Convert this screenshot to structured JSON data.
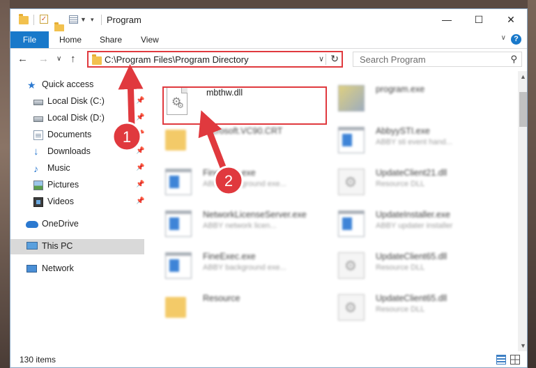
{
  "window": {
    "title": "Program",
    "controls": {
      "minimize": "—",
      "maximize": "☐",
      "close": "✕"
    }
  },
  "ribbon": {
    "file_tab": "File",
    "tabs": [
      "Home",
      "Share",
      "View"
    ]
  },
  "address": {
    "path": "C:\\Program Files\\Program Directory",
    "search_placeholder": "Search Program"
  },
  "nav": {
    "items": [
      {
        "label": "Quick access",
        "icon": "star-icon"
      },
      {
        "label": "Local Disk (C:)",
        "icon": "drive-icon",
        "pinned": true
      },
      {
        "label": "Local Disk (D:)",
        "icon": "drive-icon",
        "pinned": true
      },
      {
        "label": "Documents",
        "icon": "documents-icon",
        "pinned": true
      },
      {
        "label": "Downloads",
        "icon": "download-icon",
        "pinned": true
      },
      {
        "label": "Music",
        "icon": "music-icon",
        "pinned": true
      },
      {
        "label": "Pictures",
        "icon": "pictures-icon",
        "pinned": true
      },
      {
        "label": "Videos",
        "icon": "videos-icon",
        "pinned": true
      },
      {
        "label": "OneDrive",
        "icon": "cloud-icon"
      },
      {
        "label": "This PC",
        "icon": "pc-icon",
        "selected": true
      },
      {
        "label": "Network",
        "icon": "network-icon"
      }
    ]
  },
  "files": {
    "highlighted": {
      "name": "mbthw.dll"
    },
    "items": [
      {
        "name": "program.exe",
        "desc": "",
        "icon": "program-icon"
      },
      {
        "name": "Microsoft.VC90.CRT",
        "desc": "",
        "icon": "folder-icon"
      },
      {
        "name": "AbbyySTI.exe",
        "desc": "ABBY sti event hand...",
        "icon": "exe-icon"
      },
      {
        "name": "FineExec.exe",
        "desc": "ABBY background exe...",
        "icon": "exe-icon"
      },
      {
        "name": "UpdateClient21.dll",
        "desc": "Resource DLL",
        "icon": "dll-icon"
      },
      {
        "name": "NetworkLicenseServer.exe",
        "desc": "ABBY network licen...",
        "icon": "exe-icon"
      },
      {
        "name": "UpdateInstaller.exe",
        "desc": "ABBY updater installer",
        "icon": "exe-icon"
      },
      {
        "name": "FineExec.exe",
        "desc": "ABBY background exe...",
        "icon": "exe-icon"
      },
      {
        "name": "UpdateClient65.dll",
        "desc": "Resource DLL",
        "icon": "dll-icon"
      },
      {
        "name": "Resource",
        "desc": "",
        "icon": "folder-icon"
      },
      {
        "name": "UpdateClient65.dll",
        "desc": "Resource DLL",
        "icon": "dll-icon"
      }
    ]
  },
  "status": {
    "item_count": "130 items"
  },
  "annotations": {
    "step1": "1",
    "step2": "2",
    "color": "#e0393e"
  }
}
